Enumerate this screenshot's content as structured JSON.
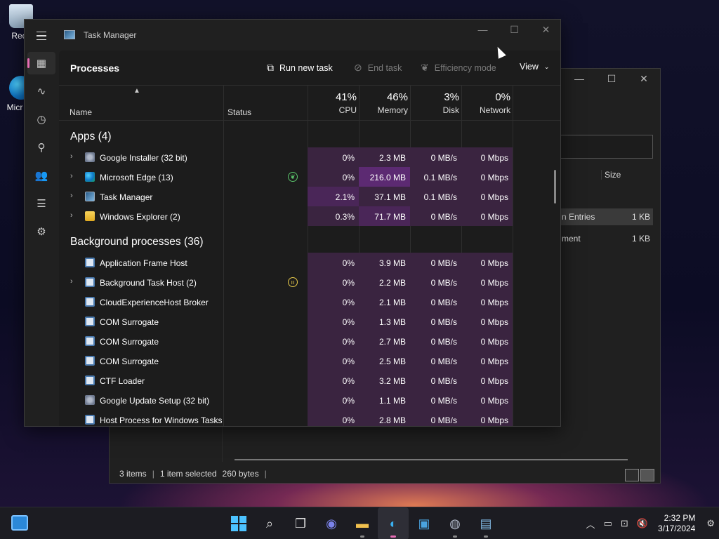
{
  "desktop": {
    "icons": [
      {
        "label": "Recy",
        "icon": "recycle-bin-icon"
      },
      {
        "label": "Micr Ed",
        "icon": "edge-icon"
      }
    ]
  },
  "explorer": {
    "size_header": "Size",
    "rows": [
      {
        "name": "n Entries",
        "size": "1 KB"
      },
      {
        "name": "ment",
        "size": "1 KB"
      }
    ],
    "status": {
      "items": "3 items",
      "selected": "1 item selected",
      "bytes": "260 bytes"
    }
  },
  "taskmanager": {
    "title": "Task Manager",
    "page_title": "Processes",
    "commands": {
      "run": "Run new task",
      "end": "End task",
      "efficiency": "Efficiency mode",
      "view": "View"
    },
    "columns": {
      "name": "Name",
      "status": "Status",
      "cpu": {
        "pct": "41%",
        "label": "CPU"
      },
      "memory": {
        "pct": "46%",
        "label": "Memory"
      },
      "disk": {
        "pct": "3%",
        "label": "Disk"
      },
      "network": {
        "pct": "0%",
        "label": "Network"
      }
    },
    "groups": {
      "apps": "Apps (4)",
      "background": "Background processes (36)"
    },
    "apps": [
      {
        "name": "Google Installer (32 bit)",
        "cpu": "0%",
        "mem": "2.3 MB",
        "disk": "0 MB/s",
        "net": "0 Mbps",
        "icon": "gear"
      },
      {
        "name": "Microsoft Edge (13)",
        "cpu": "0%",
        "mem": "216.0 MB",
        "disk": "0.1 MB/s",
        "net": "0 Mbps",
        "icon": "edge"
      },
      {
        "name": "Task Manager",
        "cpu": "2.1%",
        "mem": "37.1 MB",
        "disk": "0.1 MB/s",
        "net": "0 Mbps",
        "icon": "tm"
      },
      {
        "name": "Windows Explorer (2)",
        "cpu": "0.3%",
        "mem": "71.7 MB",
        "disk": "0 MB/s",
        "net": "0 Mbps",
        "icon": "folder"
      }
    ],
    "background": [
      {
        "name": "Application Frame Host",
        "cpu": "0%",
        "mem": "3.9 MB",
        "disk": "0 MB/s",
        "net": "0 Mbps"
      },
      {
        "name": "Background Task Host (2)",
        "cpu": "0%",
        "mem": "2.2 MB",
        "disk": "0 MB/s",
        "net": "0 Mbps"
      },
      {
        "name": "CloudExperienceHost Broker",
        "cpu": "0%",
        "mem": "2.1 MB",
        "disk": "0 MB/s",
        "net": "0 Mbps"
      },
      {
        "name": "COM Surrogate",
        "cpu": "0%",
        "mem": "1.3 MB",
        "disk": "0 MB/s",
        "net": "0 Mbps"
      },
      {
        "name": "COM Surrogate",
        "cpu": "0%",
        "mem": "2.7 MB",
        "disk": "0 MB/s",
        "net": "0 Mbps"
      },
      {
        "name": "COM Surrogate",
        "cpu": "0%",
        "mem": "2.5 MB",
        "disk": "0 MB/s",
        "net": "0 Mbps"
      },
      {
        "name": "CTF Loader",
        "cpu": "0%",
        "mem": "3.2 MB",
        "disk": "0 MB/s",
        "net": "0 Mbps"
      },
      {
        "name": "Google Update Setup (32 bit)",
        "cpu": "0%",
        "mem": "1.1 MB",
        "disk": "0 MB/s",
        "net": "0 Mbps"
      },
      {
        "name": "Host Process for Windows Tasks",
        "cpu": "0%",
        "mem": "2.8 MB",
        "disk": "0 MB/s",
        "net": "0 Mbps"
      }
    ]
  },
  "taskbar": {
    "time": "2:32 PM",
    "date": "3/17/2024"
  },
  "colors": {
    "accent": "#e76cb5",
    "heat_low": "#3a2440",
    "heat_mid": "#4a2658",
    "heat_high": "#5c2a72"
  }
}
